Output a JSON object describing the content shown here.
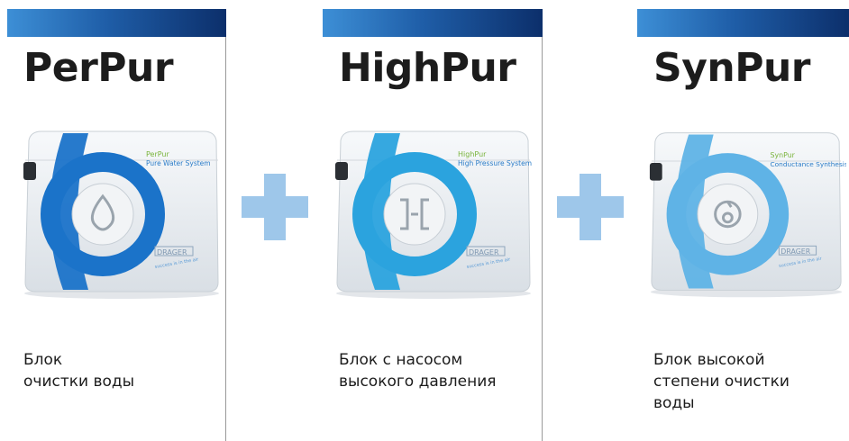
{
  "products": [
    {
      "title": "PerPur",
      "box_title": "PerPur",
      "box_subtitle": "Pure Water System",
      "description_lines": [
        "Блок",
        "очистки воды"
      ],
      "swirl_color": "#1b73c9",
      "icon": "water-drop-icon"
    },
    {
      "title": "HighPur",
      "box_title": "HighPur",
      "box_subtitle": "High Pressure System",
      "description_lines": [
        "Блок с насосом",
        "высокого давления"
      ],
      "swirl_color": "#2ba3de",
      "icon": "pump-icon"
    },
    {
      "title": "SynPur",
      "box_title": "SynPur",
      "box_subtitle": "Conductance Synthesis",
      "description_lines": [
        "Блок высокой",
        "степени очистки",
        "воды"
      ],
      "swirl_color": "#5fb3e6",
      "icon": "conductance-icon"
    }
  ],
  "brand": {
    "logo_text": "DRAGER",
    "tagline": "success is in the air"
  },
  "colors": {
    "header_gradient_start": "#3d8fd6",
    "header_gradient_end": "#0c2f6b",
    "plus_sign": "#9ec7ea",
    "box_title_green": "#7ab43c"
  }
}
